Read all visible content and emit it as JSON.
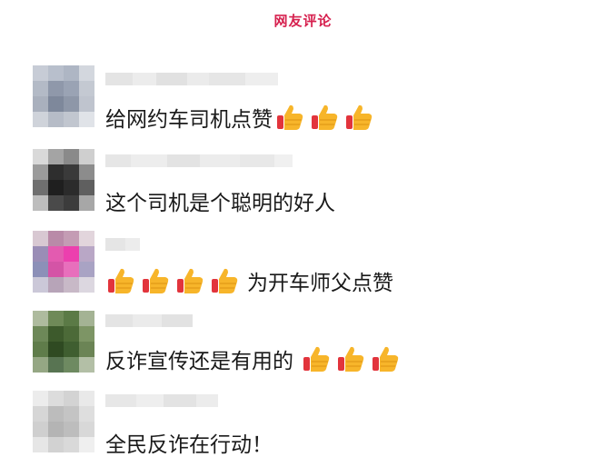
{
  "header": {
    "title": "网友评论"
  },
  "comments": [
    {
      "text": "给网约车司机点赞",
      "thumbs_after": 3,
      "thumbs_before": 0
    },
    {
      "text": "这个司机是个聪明的好人",
      "thumbs_after": 0,
      "thumbs_before": 0
    },
    {
      "text": "为开车师父点赞",
      "thumbs_after": 0,
      "thumbs_before": 4
    },
    {
      "text": "反诈宣传还是有用的",
      "thumbs_after": 3,
      "thumbs_before": 0
    },
    {
      "text": "全民反诈在行动！",
      "thumbs_after": 0,
      "thumbs_before": 0
    }
  ],
  "colors": {
    "title": "#d6204e",
    "thumb_yellow": "#f7b52a",
    "thumb_red": "#e2343c"
  },
  "icons": {
    "thumb": "thumbs-up-icon",
    "avatar": "blurred-avatar",
    "username": "blurred-username"
  }
}
